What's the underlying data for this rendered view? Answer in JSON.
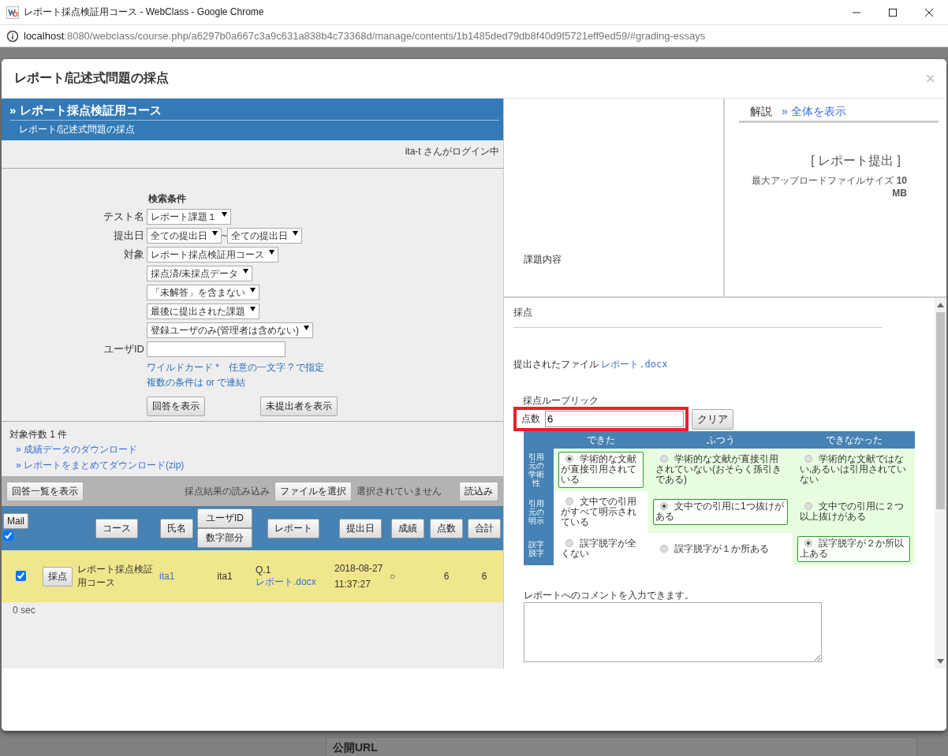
{
  "browser": {
    "title": "レポート採点検証用コース - WebClass - Google Chrome",
    "url_host": "localhost",
    "url_path": ":8080/webclass/course.php/a6297b0a667c3a9c631a838b4c73368d/manage/contents/1b1485ded79db8f40d9f5721eff9ed59/#grading-essays"
  },
  "modal": {
    "title": "レポート/記述式問題の採点",
    "close": "×"
  },
  "left": {
    "course_title": "» レポート採点検証用コース",
    "subtitle": "レポート/記述式問題の採点",
    "login": "ita-t さんがログイン中",
    "search": {
      "heading": "検索条件",
      "rows": [
        {
          "label": "テスト名",
          "selects": [
            "レポート課題１"
          ]
        },
        {
          "label": "提出日",
          "selects": [
            "全ての提出日",
            "全ての提出日"
          ],
          "separator": "~"
        },
        {
          "label": "対象",
          "selects": [
            "レポート採点検証用コース"
          ]
        },
        {
          "label": "",
          "selects": [
            "採点済/未採点データ"
          ]
        },
        {
          "label": "",
          "selects": [
            "「未解答」を含まない"
          ]
        },
        {
          "label": "",
          "selects": [
            "最後に提出された課題"
          ]
        },
        {
          "label": "",
          "selects": [
            "登録ユーザのみ(管理者は含めない)"
          ]
        }
      ],
      "user_id_label": "ユーザID",
      "hints": [
        "ワイルドカード *　任意の一文字 ? で指定",
        "複数の条件は or で連結"
      ],
      "buttons": [
        "回答を表示",
        "未提出者を表示"
      ]
    },
    "count": "対象件数 1 件",
    "links": [
      "» 成績データのダウンロード",
      "» レポートをまとめてダウンロード(zip)"
    ],
    "toolbar": {
      "list_button": "回答一覧を表示",
      "import_label": "採点結果の読み込み",
      "file_button": "ファイルを選択",
      "file_status": "選択されていません",
      "load_button": "読込み"
    },
    "table": {
      "columns": [
        "Mail",
        "コース",
        "氏名",
        "ユーザID",
        "数字部分",
        "レポート",
        "提出日",
        "成績",
        "点数",
        "合計"
      ],
      "mail_all_checked": true,
      "rows": [
        {
          "checked": true,
          "grade_button": "採点",
          "course": "レポート採点検証用コース",
          "user_id": "ita1",
          "name": "ita1",
          "question": "Q.1",
          "report": "レポート.docx",
          "date": "2018-08-27 11:37:27",
          "result": "○",
          "score": "6",
          "total": "6"
        }
      ]
    },
    "timing": "0 sec"
  },
  "right": {
    "task_label": "課題内容",
    "tab": "解説",
    "tab_link": "» 全体を表示",
    "submit_heading": "[ レポート提出 ]",
    "upload_note": "最大アップロードファイルサイズ **10 MB**",
    "grading": {
      "heading": "採点",
      "file_label": "提出されたファイル",
      "file_link": "レポート.docx",
      "rubric_label": "採点ルーブリック",
      "score_label": "点数",
      "score_value": "6",
      "clear_button": "クリア",
      "rubric": {
        "levels": [
          "できた",
          "ふつう",
          "できなかった"
        ],
        "criteria": [
          {
            "name": "引用元の学術性",
            "options": [
              {
                "text": "学術的な文献が直接引用されている",
                "selected": true
              },
              {
                "text": "学術的な文献が直接引用されていない(おそらく孫引きである)",
                "selected": false
              },
              {
                "text": "学術的な文献ではない,あるいは引用されていない",
                "selected": false
              }
            ]
          },
          {
            "name": "引用元の明示",
            "options": [
              {
                "text": "文中での引用がすべて明示されている",
                "selected": false
              },
              {
                "text": "文中での引用に1つ抜けがある",
                "selected": true
              },
              {
                "text": "文中での引用に２つ以上抜けがある",
                "selected": false
              }
            ]
          },
          {
            "name": "誤字脱字",
            "options": [
              {
                "text": "誤字脱字が全くない",
                "selected": false
              },
              {
                "text": "誤字脱字が１か所ある",
                "selected": false
              },
              {
                "text": "誤字脱字が２か所以上ある",
                "selected": true
              }
            ]
          }
        ]
      },
      "comment_label": "レポートへのコメントを入力できます。"
    }
  },
  "background": {
    "public_url": "公開URL"
  }
}
